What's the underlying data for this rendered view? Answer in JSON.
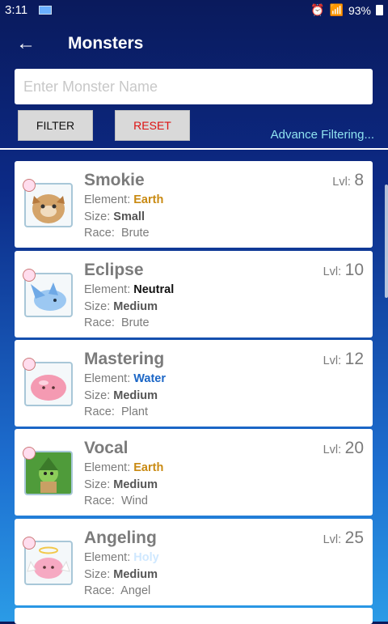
{
  "status": {
    "time": "3:11",
    "battery": "93%"
  },
  "appbar": {
    "title": "Monsters"
  },
  "search": {
    "placeholder": "Enter Monster Name"
  },
  "buttons": {
    "filter": "FILTER",
    "reset": "RESET",
    "advanced": "Advance Filtering..."
  },
  "labels": {
    "element": "Element:",
    "size": "Size:",
    "race": "Race:",
    "level": "Lvl:"
  },
  "monsters": [
    {
      "name": "Smokie",
      "element": "Earth",
      "element_color": "#c98a12",
      "size": "Small",
      "race": "Brute",
      "level": "8"
    },
    {
      "name": "Eclipse",
      "element": "Neutral",
      "element_color": "#111111",
      "size": "Medium",
      "race": "Brute",
      "level": "10"
    },
    {
      "name": "Mastering",
      "element": "Water",
      "element_color": "#1b66c6",
      "size": "Medium",
      "race": "Plant",
      "level": "12"
    },
    {
      "name": "Vocal",
      "element": "Earth",
      "element_color": "#c98a12",
      "size": "Medium",
      "race": "Wind",
      "level": "20"
    },
    {
      "name": "Angeling",
      "element": "Holy",
      "element_color": "#cfe8ff",
      "size": "Medium",
      "race": "Angel",
      "level": "25"
    }
  ]
}
